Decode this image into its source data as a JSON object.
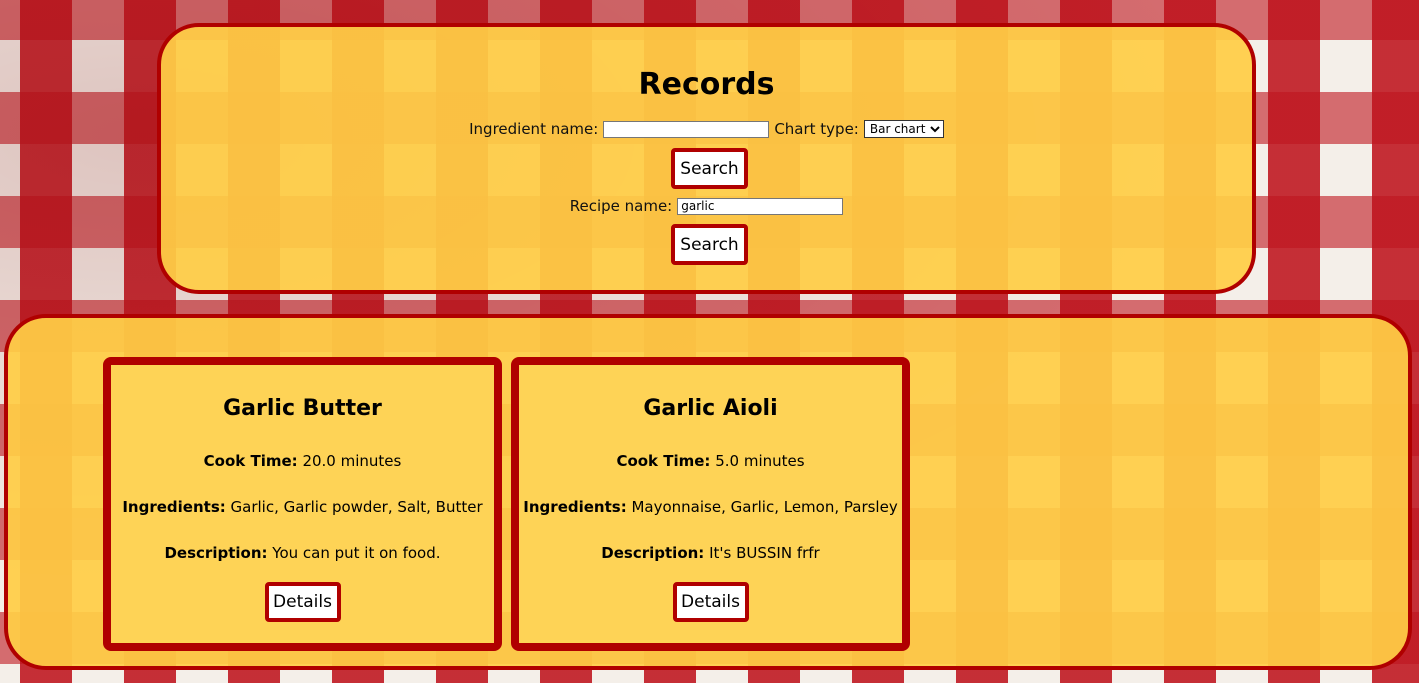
{
  "header": {
    "title": "Records"
  },
  "search": {
    "ingredient_label": "Ingredient name:",
    "ingredient_value": "",
    "chart_type_label": "Chart type:",
    "chart_type_selected": "Bar chart",
    "search_button": "Search",
    "recipe_label": "Recipe name:",
    "recipe_value": "garlic",
    "recipe_search_button": "Search"
  },
  "results": [
    {
      "name": "Garlic Butter",
      "cook_time_label": "Cook Time:",
      "cook_time": "20.0 minutes",
      "ingredients_label": "Ingredients:",
      "ingredients": "Garlic, Garlic powder, Salt, Butter",
      "description_label": "Description:",
      "description": "You can put it on food.",
      "details_button": "Details"
    },
    {
      "name": "Garlic Aioli",
      "cook_time_label": "Cook Time:",
      "cook_time": "5.0 minutes",
      "ingredients_label": "Ingredients:",
      "ingredients": "Mayonnaise, Garlic, Lemon, Parsley",
      "description_label": "Description:",
      "description": "It's BUSSIN frfr",
      "details_button": "Details"
    }
  ],
  "colors": {
    "accent": "#b00000",
    "panel": "#fed356"
  }
}
